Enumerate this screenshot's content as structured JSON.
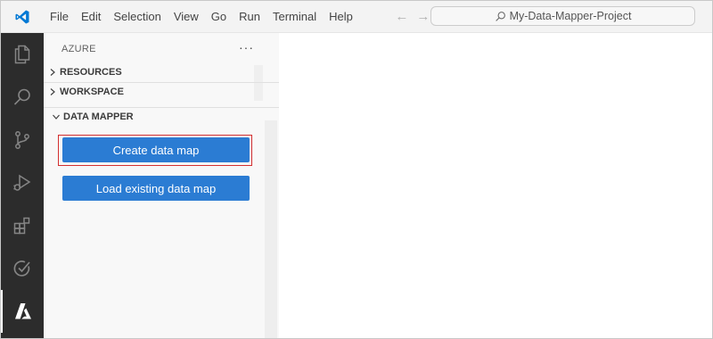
{
  "titlebar": {
    "menu": [
      "File",
      "Edit",
      "Selection",
      "View",
      "Go",
      "Run",
      "Terminal",
      "Help"
    ],
    "back_arrow": "←",
    "forward_arrow": "→",
    "search_text": "My-Data-Mapper-Project"
  },
  "activity_bar": {
    "icons": [
      "explorer-icon",
      "search-icon",
      "source-control-icon",
      "run-debug-icon",
      "extensions-icon",
      "testing-icon",
      "azure-icon"
    ],
    "active": "azure-icon"
  },
  "sidebar": {
    "title": "AZURE",
    "more": "···",
    "sections": [
      {
        "label": "RESOURCES",
        "expanded": false
      },
      {
        "label": "WORKSPACE",
        "expanded": false
      },
      {
        "label": "DATA MAPPER",
        "expanded": true
      }
    ],
    "buttons": {
      "create": "Create data map",
      "load": "Load existing data map"
    }
  },
  "colors": {
    "activity_bar_bg": "#2c2c2c",
    "button_bg": "#2b7cd3",
    "highlight_border": "#d32f2f",
    "vscode_blue": "#0078d4"
  }
}
